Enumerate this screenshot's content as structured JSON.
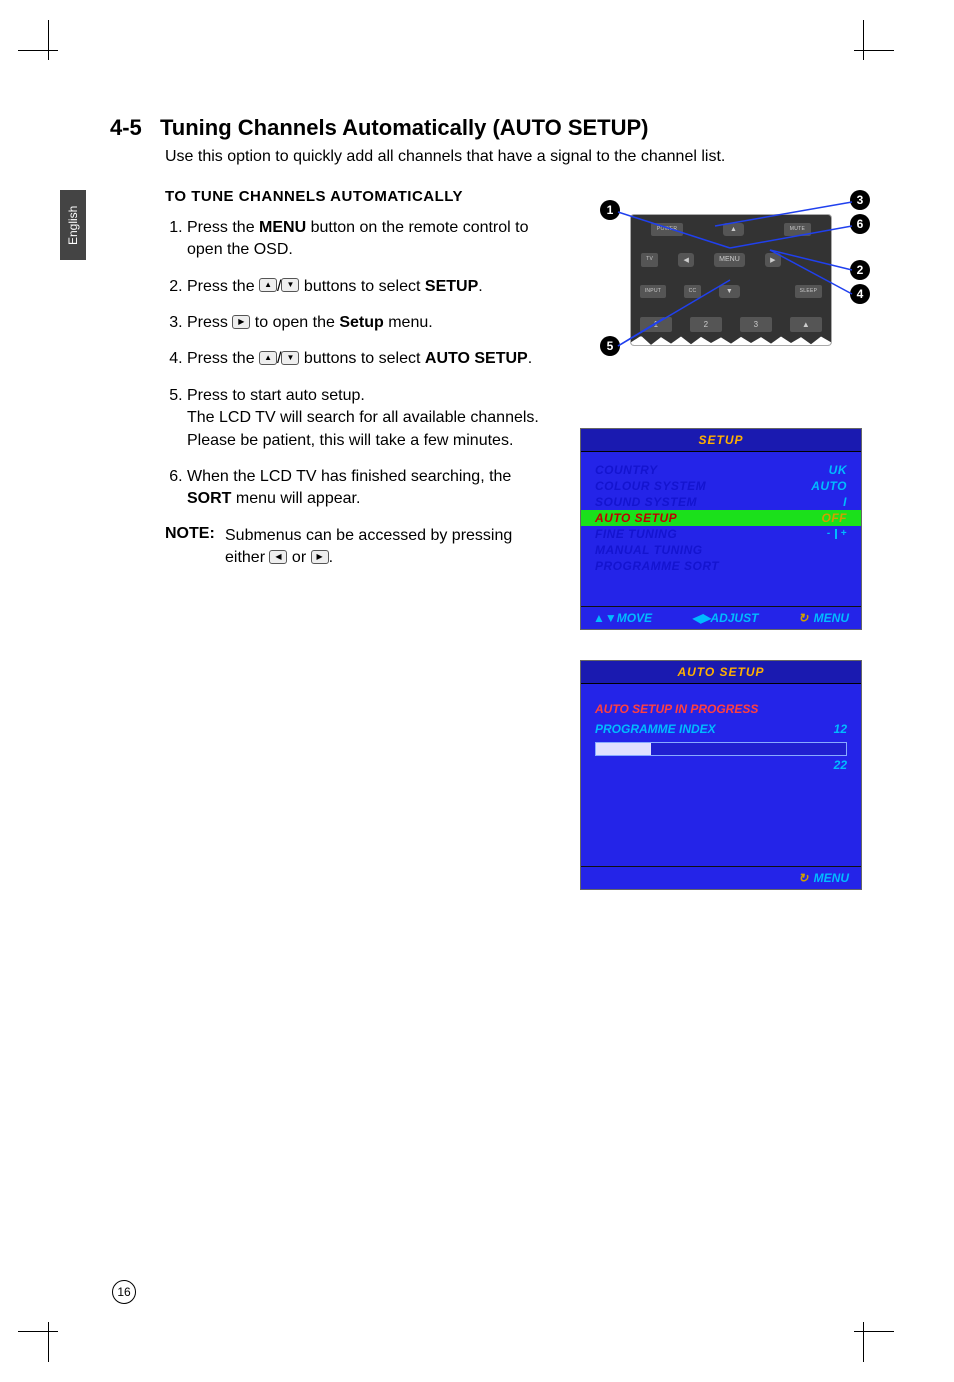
{
  "page": {
    "language_tab": "English",
    "section_number": "4-5",
    "section_title": "Tuning Channels Automatically (AUTO SETUP)",
    "intro": "Use this option to quickly add all channels that have a signal to the channel list.",
    "page_number": "16"
  },
  "instructions": {
    "heading": "TO TUNE CHANNELS AUTOMATICALLY",
    "steps": [
      {
        "pre": "Press the ",
        "bold1": "MENU",
        "post": " button on the remote control to open the OSD."
      },
      {
        "pre": "Press the  ",
        "icons": "updown",
        "mid": "  buttons to select ",
        "bold1": "SETUP",
        "post": "."
      },
      {
        "pre": "Press ",
        "icons": "right",
        "mid": " to open the ",
        "bold1": "Setup",
        "post": " menu."
      },
      {
        "pre": "Press the  ",
        "icons": "updown",
        "mid": "  buttons to select ",
        "bold1": "AUTO SETUP",
        "post": "."
      },
      {
        "pre": "Press to start auto setup.",
        "post2": "The LCD TV will search for all available channels. Please be patient, this will take a few minutes."
      },
      {
        "pre": "When the LCD TV has finished searching, the ",
        "bold1": "SORT",
        "post": " menu will appear."
      }
    ],
    "note_label": "NOTE:",
    "note_text_a": "Submenus can be accessed by pressing either ",
    "note_text_b": " or ",
    "note_text_c": "."
  },
  "remote": {
    "callouts": [
      "1",
      "2",
      "3",
      "4",
      "5",
      "6"
    ],
    "buttons": {
      "power": "POWER",
      "mute": "MUTE",
      "tv": "TV",
      "input": "INPUT",
      "menu": "MENU",
      "cc": "CC",
      "sleep": "SLEEP",
      "num1": "1",
      "num2": "2",
      "num3": "3"
    }
  },
  "osd1": {
    "title": "SETUP",
    "rows": [
      {
        "label": "COUNTRY",
        "value": "UK"
      },
      {
        "label": "COLOUR SYSTEM",
        "value": "AUTO"
      },
      {
        "label": "SOUND SYSTEM",
        "value": "I"
      },
      {
        "label": "AUTO SETUP",
        "value": "OFF",
        "highlight": true
      },
      {
        "label": "FINE TUNING",
        "value": "",
        "bar": true
      },
      {
        "label": "MANUAL TUNING",
        "value": ""
      },
      {
        "label": "PROGRAMME SORT",
        "value": ""
      }
    ],
    "footer": {
      "move": "MOVE",
      "adjust": "ADJUST",
      "menu": "MENU"
    }
  },
  "osd2": {
    "title": "AUTO SETUP",
    "status": "AUTO SETUP IN PROGRESS",
    "prog_label": "PROGRAMME INDEX",
    "prog_value": "12",
    "counter": "22",
    "footer_menu": "MENU"
  }
}
